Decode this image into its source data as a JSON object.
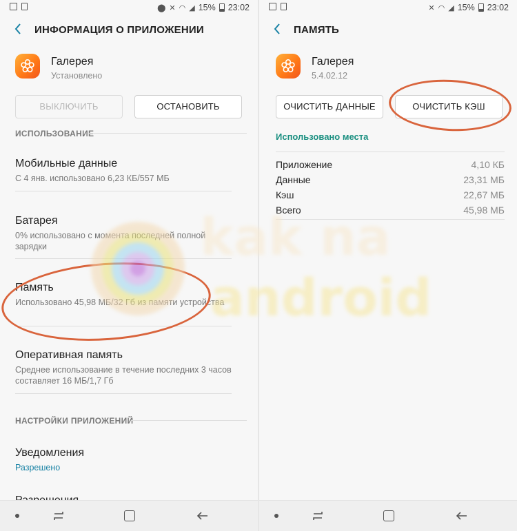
{
  "status_bar": {
    "battery": "15%",
    "time": "23:02"
  },
  "left": {
    "header": {
      "title": "ИНФОРМАЦИЯ О ПРИЛОЖЕНИИ"
    },
    "app": {
      "name": "Галерея",
      "status": "Установлено"
    },
    "buttons": {
      "disable": "ВЫКЛЮЧИТЬ",
      "stop": "ОСТАНОВИТЬ"
    },
    "usage_header": "ИСПОЛЬЗОВАНИЕ",
    "items": [
      {
        "title": "Мобильные данные",
        "sub": "С 4 янв. использовано 6,23 КБ/557 МБ"
      },
      {
        "title": "Батарея",
        "sub": "0% использовано с момента последней полной зарядки"
      },
      {
        "title": "Память",
        "sub": "Использовано 45,98 МБ/32 Гб из памяти устройства"
      },
      {
        "title": "Оперативная память",
        "sub": "Среднее использование в течение последних 3 часов составляет 16 МБ/1,7 Гб"
      }
    ],
    "settings_header": "НАСТРОЙКИ ПРИЛОЖЕНИЙ",
    "notifications": {
      "title": "Уведомления",
      "sub": "Разрешено"
    },
    "permissions": {
      "title": "Разрешения"
    }
  },
  "right": {
    "header": {
      "title": "ПАМЯТЬ"
    },
    "app": {
      "name": "Галерея",
      "version": "5.4.02.12"
    },
    "buttons": {
      "clear_data": "ОЧИСТИТЬ ДАННЫЕ",
      "clear_cache": "ОЧИСТИТЬ КЭШ"
    },
    "used_header": "Использовано места",
    "rows": [
      {
        "label": "Приложение",
        "value": "4,10 КБ"
      },
      {
        "label": "Данные",
        "value": "23,31 МБ"
      },
      {
        "label": "Кэш",
        "value": "22,67 МБ"
      },
      {
        "label": "Всего",
        "value": "45,98 МБ"
      }
    ]
  },
  "watermark": {
    "line1": "kak na",
    "line2": "android"
  },
  "colors": {
    "accent": "#1a83a5",
    "teal": "#1a8f80",
    "highlight": "#d9643c",
    "app_icon": "#ff7a18"
  }
}
